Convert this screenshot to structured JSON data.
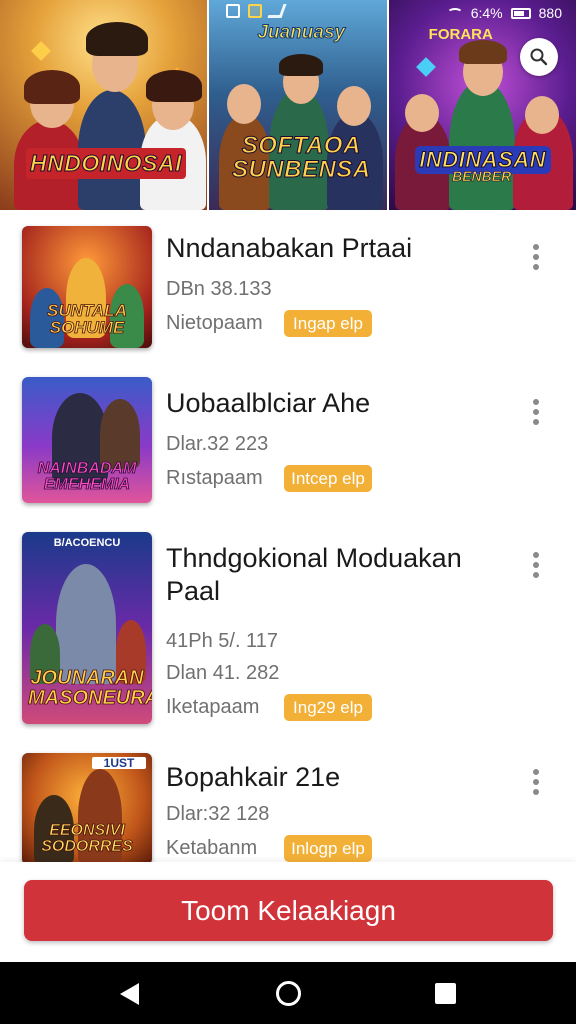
{
  "status_bar": {
    "time_text": "6:4%",
    "battery_text": "880"
  },
  "banner": {
    "panels": [
      {
        "title": "HNDOINOSAI",
        "top_label": ""
      },
      {
        "title": "SOFTAOA SUNBENSA",
        "top_label": "Juanuasy"
      },
      {
        "title": "INDINASAN",
        "subtitle": "BENBER",
        "top_label": "FORARA"
      }
    ]
  },
  "search": {
    "icon": "search-icon"
  },
  "games": [
    {
      "title": "Nndanabakan Prtaai",
      "line1": "DBn 38.133",
      "line2": "",
      "category": "Nietopaam",
      "tag": "Ingap elp",
      "thumb_title": "SUNTALA SOHUME"
    },
    {
      "title": "Uobaalblciar Ahe",
      "line1": "Dlar.32 223",
      "line2": "",
      "category": "Rıstapaam",
      "tag": "Intcep elp",
      "thumb_title": "NAINBADAM ЕМЕНЕМІА"
    },
    {
      "title": "Thndgokional Moduakan Paal",
      "line1": "41Ph 5/. 117",
      "line2": "Dlan 41. 282",
      "category": "Iketapaam",
      "tag": "Ing29 elp",
      "thumb_title": "JOUNARAN MASONEURA",
      "thumb_top": "B/ACOENCU"
    },
    {
      "title": "Bopahkair 21e",
      "line1": "Dlar:32 128",
      "line2": "",
      "category": "Ketabanm",
      "tag": "Inlogp elp",
      "thumb_title": "EEONSIVI SODORRES",
      "thumb_top": "1UST"
    }
  ],
  "cta": {
    "label": "Toom Kelaakiagn"
  },
  "colors": {
    "accent_red": "#d03339",
    "tag_orange": "#f2b037",
    "text_primary": "#1a1a1a",
    "text_secondary": "#707070"
  }
}
